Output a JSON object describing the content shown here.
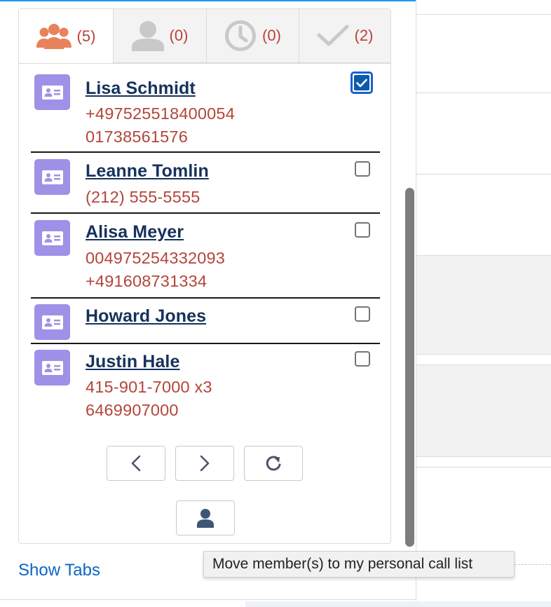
{
  "tabs": [
    {
      "name": "tab-all",
      "icon": "group-icon",
      "count": "(5)",
      "active": true
    },
    {
      "name": "tab-personal",
      "icon": "user-icon",
      "count": "(0)",
      "active": false
    },
    {
      "name": "tab-scheduled",
      "icon": "clock-icon",
      "count": "(0)",
      "active": false
    },
    {
      "name": "tab-completed",
      "icon": "check-icon",
      "count": "(2)",
      "active": false
    }
  ],
  "contacts": [
    {
      "name": "Lisa Schmidt",
      "phones": [
        "+497525518400054",
        "01738561576"
      ],
      "checked": true
    },
    {
      "name": "Leanne Tomlin",
      "phones": [
        "(212) 555-5555"
      ],
      "checked": false
    },
    {
      "name": "Alisa Meyer",
      "phones": [
        "004975254332093",
        "+491608731334"
      ],
      "checked": false
    },
    {
      "name": "Howard Jones",
      "phones": [],
      "checked": false
    },
    {
      "name": "Justin Hale",
      "phones": [
        "415-901-7000 x3",
        "6469907000"
      ],
      "checked": false
    }
  ],
  "pagination": {
    "prev_icon": "chevron-left-icon",
    "next_icon": "chevron-right-icon",
    "refresh_icon": "refresh-icon"
  },
  "move_button_icon": "user-icon",
  "tooltip": "Move member(s) to my personal call list",
  "show_tabs_label": "Show Tabs",
  "colors": {
    "accent": "#1b96ff",
    "contact_icon_bg": "#9e91e8",
    "phone_text": "#b3453b",
    "name_text": "#16325c",
    "tab_icon_active": "#e8825c",
    "tab_icon_inactive": "#c9c9c9",
    "checkbox_checked": "#0b5cab"
  }
}
